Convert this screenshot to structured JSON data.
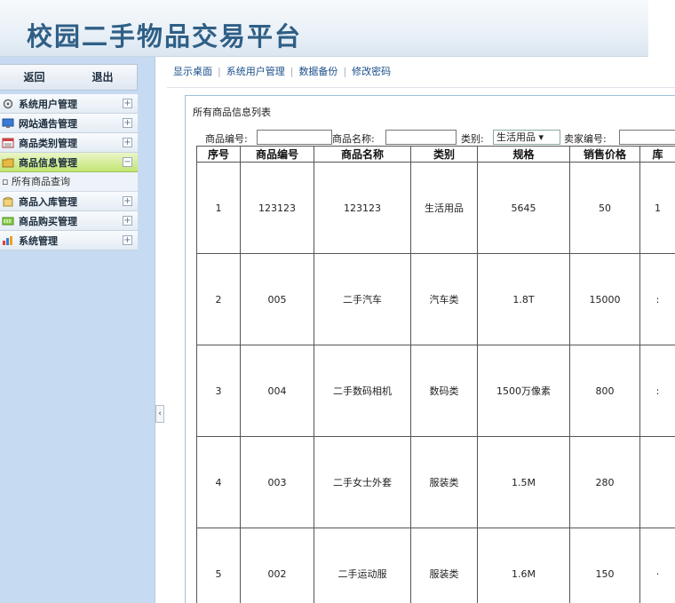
{
  "app": {
    "title": "校园二手物品交易平台"
  },
  "sidebar": {
    "buttons": {
      "back": "返回",
      "logout": "退出"
    },
    "items": [
      {
        "label": "系统用户管理",
        "icon": "gear-icon",
        "expanded": false
      },
      {
        "label": "网站通告管理",
        "icon": "monitor-icon",
        "expanded": false
      },
      {
        "label": "商品类别管理",
        "icon": "list-icon",
        "expanded": false
      },
      {
        "label": "商品信息管理",
        "icon": "folder-icon",
        "expanded": true
      },
      {
        "label": "商品入库管理",
        "icon": "box-icon",
        "expanded": false
      },
      {
        "label": "商品购买管理",
        "icon": "cart-icon",
        "expanded": false
      },
      {
        "label": "系统管理",
        "icon": "chart-icon",
        "expanded": false
      }
    ],
    "subitem": "所有商品查询",
    "collapse_glyph": "‹",
    "plus_glyph": "+",
    "minus_glyph": "−"
  },
  "topnav": {
    "links": [
      "显示桌面",
      "系统用户管理",
      "数据备份",
      "修改密码"
    ],
    "separator": "|"
  },
  "panel": {
    "title": "所有商品信息列表",
    "search": {
      "code_label": "商品编号:",
      "name_label": "商品名称:",
      "category_label": "类别:",
      "category_value": "生活用品 ▾",
      "seller_label": "卖家编号:"
    }
  },
  "table": {
    "headers": [
      "序号",
      "商品编号",
      "商品名称",
      "类别",
      "规格",
      "销售价格",
      "库"
    ],
    "rows": [
      [
        "1",
        "123123",
        "123123",
        "生活用品",
        "5645",
        "50",
        "1"
      ],
      [
        "2",
        "005",
        "二手汽车",
        "汽车类",
        "1.8T",
        "15000",
        ":"
      ],
      [
        "3",
        "004",
        "二手数码相机",
        "数码类",
        "1500万像素",
        "800",
        ":"
      ],
      [
        "4",
        "003",
        "二手女士外套",
        "服装类",
        "1.5M",
        "280",
        ""
      ],
      [
        "5",
        "002",
        "二手运动服",
        "服装类",
        "1.6M",
        "150",
        "·"
      ]
    ]
  },
  "colors": {
    "title": "#2f5f86",
    "sidebar_bg": "#c6daf2",
    "active_item": "#c3e473",
    "link": "#1a4f8a",
    "panel_border": "#9fc1d9"
  }
}
